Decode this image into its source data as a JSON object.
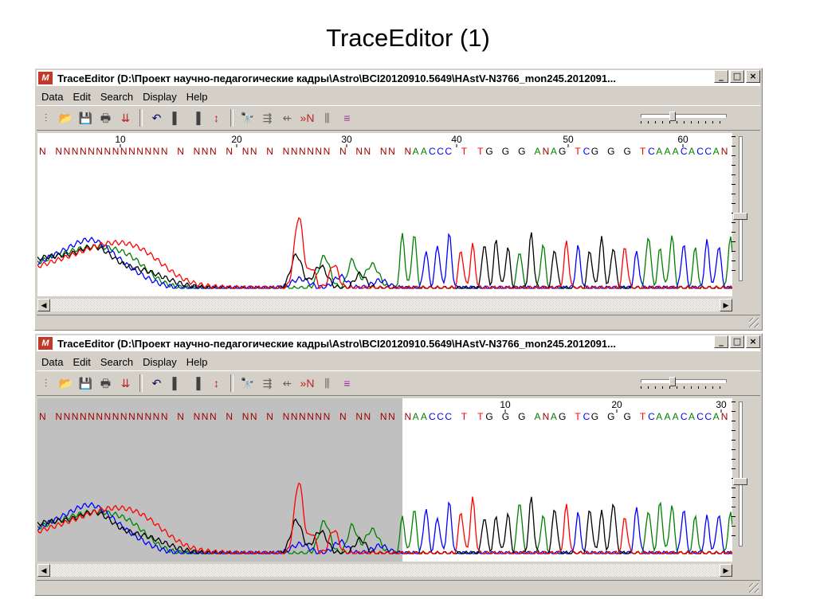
{
  "slide": {
    "title": "TraceEditor (1)"
  },
  "window_title": "TraceEditor (D:\\Проект научно-педагогические кадры\\Astro\\BCI20120910.5649\\HAstV-N3766_mon245.2012091...",
  "menu": [
    "Data",
    "Edit",
    "Search",
    "Display",
    "Help"
  ],
  "toolbar_icons": [
    "atgc-trace-icon",
    "open-folder-icon",
    "save-disk-icon",
    "print-icon",
    "import-icon",
    "undo-icon",
    "clip-left-icon",
    "clip-right-icon",
    "sort-icon",
    "find-binoculars-icon",
    "find-next-icon",
    "find-prev-icon",
    "next-n-icon",
    "peak-icon",
    "align-icon"
  ],
  "toolbar_glyphs": [
    "⫶",
    "📂",
    "💾",
    "🖶",
    "⇊",
    "↶",
    "▌",
    "▐",
    "↕",
    "🔭",
    "⇶",
    "⇷",
    "»N",
    "⫼",
    "≡"
  ],
  "window_buttons": [
    "_",
    "□",
    "×"
  ],
  "colors": {
    "A": "#008000",
    "C": "#0000ff",
    "G": "#000000",
    "T": "#ff0000",
    "N": "#a00000",
    "selection": "#c0c0c0",
    "cursor": "#000080"
  },
  "windows": [
    {
      "ruler": [
        "10",
        "20",
        "30",
        "40",
        "50",
        "60"
      ],
      "sequence": "N NNNNNNNNNNNNNN N NNN N NN N NNNNNN N NN NN NAACCC T TG G G ANAG TCG G G TCAAACACCAN"
    },
    {
      "ruler": [
        "10",
        "20",
        "30"
      ],
      "sequence": "N NNNNNNNNNNNNNN N NNN N NN N NNNNNN N NN NN NAACCC T TG G G ANAG TCG G G TCAAACACCAN",
      "selected_base": "N",
      "selected_index": 41
    }
  ]
}
